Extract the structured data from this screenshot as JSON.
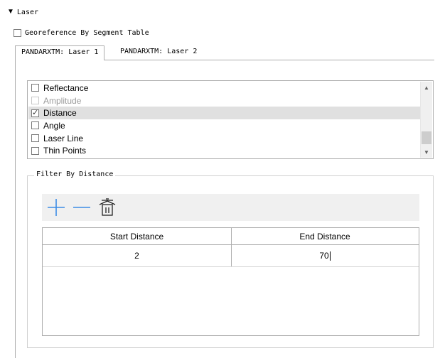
{
  "section": {
    "title": "Laser",
    "collapse_glyph": "▼"
  },
  "georeference": {
    "label": "Georeference By Segment Table",
    "checked": false
  },
  "tabs": [
    {
      "label": "PANDARXTM: Laser 1",
      "active": true
    },
    {
      "label": "PANDARXTM: Laser 2",
      "active": false
    }
  ],
  "attribute_list": {
    "items": [
      {
        "label": "Reflectance",
        "checked": false,
        "enabled": true,
        "selected": false
      },
      {
        "label": "Amplitude",
        "checked": false,
        "enabled": false,
        "selected": false
      },
      {
        "label": "Distance",
        "checked": true,
        "enabled": true,
        "selected": true
      },
      {
        "label": "Angle",
        "checked": false,
        "enabled": true,
        "selected": false
      },
      {
        "label": "Laser Line",
        "checked": false,
        "enabled": true,
        "selected": false
      },
      {
        "label": "Thin Points",
        "checked": false,
        "enabled": true,
        "selected": false
      }
    ],
    "check_glyph": "✓",
    "scroll_up_glyph": "▲",
    "scroll_down_glyph": "▼"
  },
  "filter": {
    "title": "Filter By Distance",
    "toolbar": {
      "add_icon": "plus-icon",
      "remove_icon": "minus-icon",
      "delete_icon": "trash-icon"
    },
    "table": {
      "columns": [
        "Start Distance",
        "End Distance"
      ],
      "rows": [
        {
          "start": "2",
          "end": "70"
        }
      ]
    }
  },
  "colors": {
    "toolbar_icon": "#3c8ce6",
    "selection": "#e0e0e0",
    "border": "#adadad"
  }
}
